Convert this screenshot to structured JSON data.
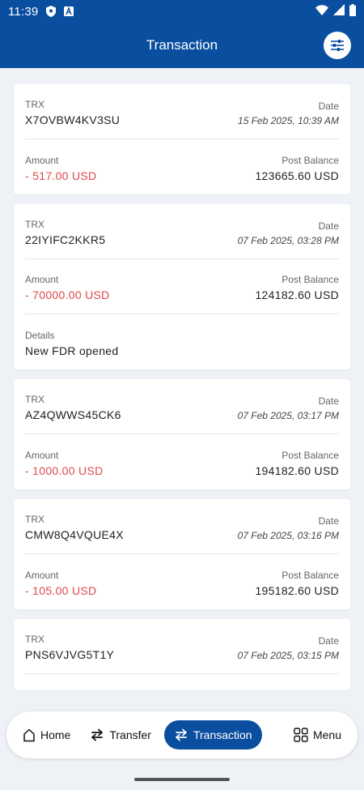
{
  "status": {
    "time": "11:39"
  },
  "header": {
    "title": "Transaction"
  },
  "labels": {
    "trx": "TRX",
    "date": "Date",
    "amount": "Amount",
    "post_balance": "Post Balance",
    "details": "Details"
  },
  "transactions": [
    {
      "trx": "X7OVBW4KV3SU",
      "date": "15 Feb 2025, 10:39 AM",
      "amount": "- 517.00  USD",
      "post_balance": "123665.60  USD"
    },
    {
      "trx": "22IYIFC2KKR5",
      "date": "07 Feb 2025, 03:28 PM",
      "amount": "- 70000.00  USD",
      "post_balance": "124182.60  USD",
      "details": "New FDR opened"
    },
    {
      "trx": "AZ4QWWS45CK6",
      "date": "07 Feb 2025, 03:17 PM",
      "amount": "- 1000.00  USD",
      "post_balance": "194182.60  USD"
    },
    {
      "trx": "CMW8Q4VQUE4X",
      "date": "07 Feb 2025, 03:16 PM",
      "amount": "- 105.00  USD",
      "post_balance": "195182.60  USD"
    },
    {
      "trx": "PNS6VJVG5T1Y",
      "date": "07 Feb 2025, 03:15 PM"
    }
  ],
  "nav": {
    "home": "Home",
    "transfer": "Transfer",
    "transaction": "Transaction",
    "menu": "Menu"
  },
  "colors": {
    "primary": "#0a4ea0",
    "negative": "#e04848"
  }
}
